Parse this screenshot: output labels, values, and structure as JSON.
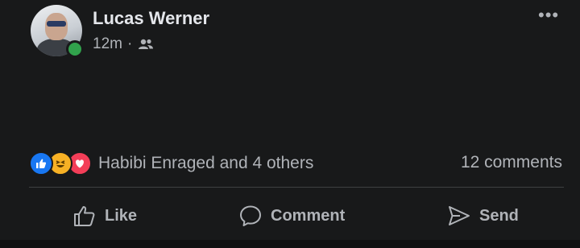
{
  "post": {
    "author": "Lucas Werner",
    "time": "12m",
    "separator": "·",
    "audience_icon": "friends-icon",
    "text": "",
    "reactions": {
      "icons": [
        "like-icon",
        "haha-icon",
        "love-icon"
      ],
      "names": "Habibi Enraged and 4 others"
    },
    "comments_count": "12 comments"
  },
  "actions": {
    "like": "Like",
    "comment": "Comment",
    "send": "Send"
  },
  "colors": {
    "background": "#18191a",
    "text": "#e4e6eb",
    "secondary": "#b0b3b8",
    "online": "#31a24c",
    "like": "#1877f2",
    "haha": "#f7b125",
    "love": "#f33e58"
  }
}
